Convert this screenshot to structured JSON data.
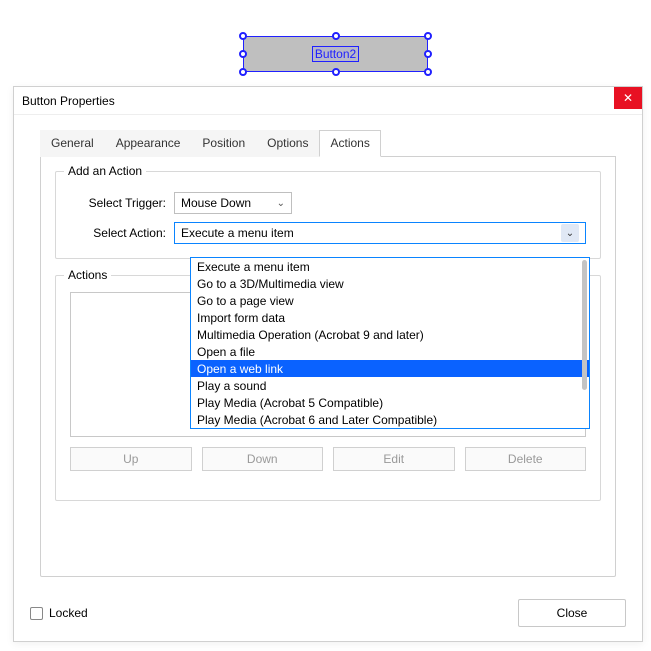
{
  "form_button": {
    "label": "Button2"
  },
  "dialog": {
    "title": "Button Properties",
    "tabs": {
      "general": "General",
      "appearance": "Appearance",
      "position": "Position",
      "options": "Options",
      "actions": "Actions"
    },
    "add_action": {
      "legend": "Add an Action",
      "trigger_label": "Select Trigger:",
      "trigger_value": "Mouse Down",
      "action_label": "Select Action:",
      "action_value": "Execute a menu item",
      "action_options": [
        "Execute a menu item",
        "Go to a 3D/Multimedia view",
        "Go to a page view",
        "Import form data",
        "Multimedia Operation (Acrobat 9 and later)",
        "Open a file",
        "Open a web link",
        "Play a sound",
        "Play Media (Acrobat 5 Compatible)",
        "Play Media (Acrobat 6 and Later Compatible)"
      ],
      "highlighted_option": "Open a web link"
    },
    "actions_section": {
      "legend": "Actions",
      "buttons": {
        "up": "Up",
        "down": "Down",
        "edit": "Edit",
        "delete": "Delete"
      }
    },
    "footer": {
      "locked_label": "Locked",
      "close_label": "Close"
    }
  }
}
